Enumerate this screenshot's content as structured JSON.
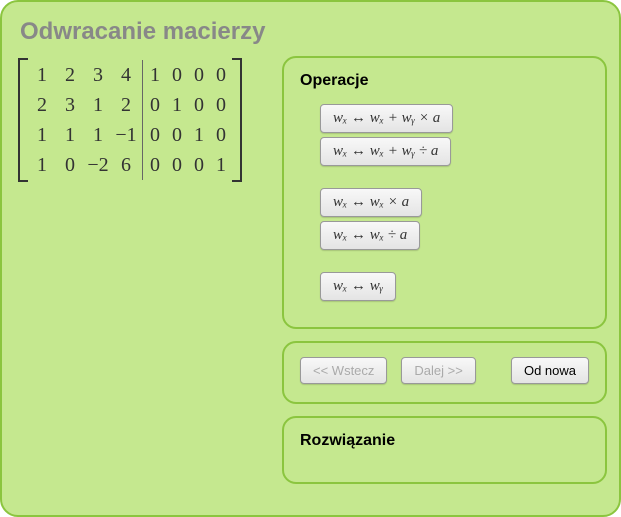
{
  "title": "Odwracanie macierzy",
  "matrix": {
    "left": [
      [
        "1",
        "2",
        "3",
        "4"
      ],
      [
        "2",
        "3",
        "1",
        "2"
      ],
      [
        "1",
        "1",
        "1",
        "−1"
      ],
      [
        "1",
        "0",
        "−2",
        "6"
      ]
    ],
    "right": [
      [
        "1",
        "0",
        "0",
        "0"
      ],
      [
        "0",
        "1",
        "0",
        "0"
      ],
      [
        "0",
        "0",
        "1",
        "0"
      ],
      [
        "0",
        "0",
        "0",
        "1"
      ]
    ]
  },
  "ops": {
    "title": "Operacje",
    "btn1": "wₓ ↔ wₓ + wᵧ × a",
    "btn2": "wₓ ↔ wₓ + wᵧ ÷ a",
    "btn3": "wₓ ↔ wₓ × a",
    "btn4": "wₓ ↔ wₓ ÷ a",
    "btn5": "wₓ ↔ wᵧ"
  },
  "nav": {
    "back": "<< Wstecz",
    "next": "Dalej >>",
    "reset": "Od nowa"
  },
  "solution": {
    "title": "Rozwiązanie"
  }
}
